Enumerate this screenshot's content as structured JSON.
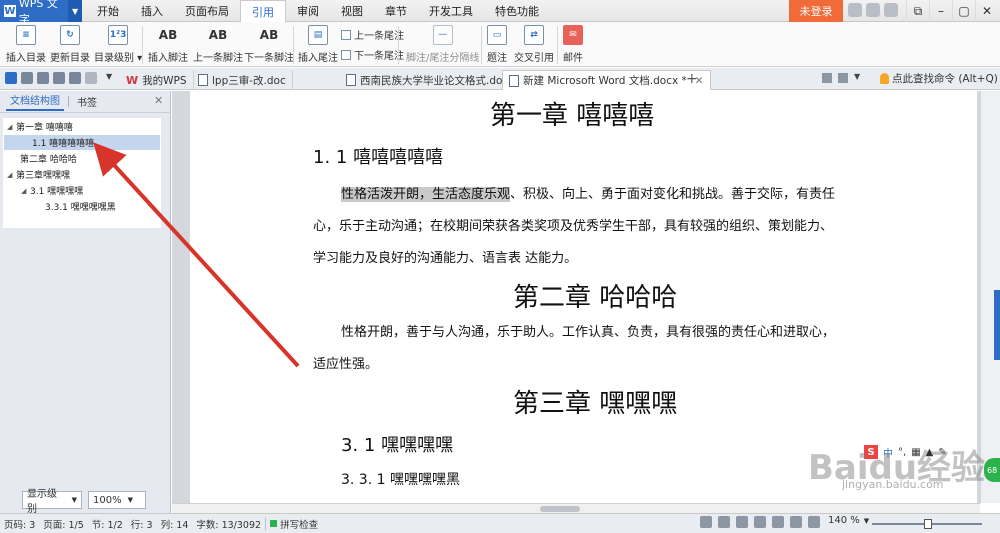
{
  "app": {
    "name": "WPS 文字",
    "login": "未登录"
  },
  "menus": [
    "开始",
    "插入",
    "页面布局",
    "引用",
    "审阅",
    "视图",
    "章节",
    "开发工具",
    "特色功能"
  ],
  "active_menu": "引用",
  "ribbon": {
    "insert_toc": "插入目录",
    "update_toc": "更新目录",
    "toc_level": "目录级别",
    "insert_footnote": "插入脚注",
    "prev_footnote": "上一条脚注",
    "next_footnote": "下一条脚注",
    "insert_endnote": "插入尾注",
    "prev_endnote": "上一条尾注",
    "next_endnote": "下一条尾注",
    "note_separator": "脚注/尾注分隔线",
    "caption": "题注",
    "cross_ref": "交叉引用",
    "mail": "邮件",
    "ab_glyph": "AB"
  },
  "tabs": [
    {
      "label": "我的WPS"
    },
    {
      "label": "lpp三审-改.doc"
    },
    {
      "label": "西南民族大学毕业论文格式.doc"
    },
    {
      "label": "新建 Microsoft Word 文档.docx *"
    }
  ],
  "search_cmd": "点此查找命令 (Alt+Q)",
  "nav": {
    "tab_toc": "文档结构图",
    "tab_bookmark": "书签",
    "tree": [
      {
        "label": "第一章  嘻嘻嘻"
      },
      {
        "label": "1.1  嘻嘻嘻嘻嘻"
      },
      {
        "label": "第二章  哈哈哈"
      },
      {
        "label": "第三章嘿嘿嘿"
      },
      {
        "label": "3.1  嘿嘿嘿嘿"
      },
      {
        "label": "3.3.1  嘿嘿嘿嘿黑"
      }
    ],
    "show_level": "显示级别",
    "zoom": "100%"
  },
  "document": {
    "ch1": "第一章    嘻嘻嘻",
    "s11": "1. 1  嘻嘻嘻嘻嘻",
    "p1_hl": "性格活泼开朗，生活态度乐观",
    "p1_a": "、积极、向上、勇于面对变化和挑战。善于交际，有责任",
    "p1_b": "心，乐于主动沟通；在校期间荣获各类奖项及优秀学生干部，具有较强的组织、策划能力、",
    "p1_c": "学习能力及良好的沟通能力、语言表  达能力。",
    "ch2": "第二章  哈哈哈",
    "p2_a": "性格开朗，善于与人沟通，乐于助人。工作认真、负责，具有很强的责任心和进取心，",
    "p2_b": "适应性强。",
    "ch3": "第三章  嘿嘿嘿",
    "s31": "3. 1  嘿嘿嘿嘿",
    "s331": "3. 3. 1  嘿嘿嘿嘿黑"
  },
  "watermark": {
    "main": "Baidu经验",
    "sub": "jingyan.baidu.com",
    "ime_cn": "中"
  },
  "status": {
    "page_num": "页码: 3",
    "page": "页面: 1/5",
    "section": "节: 1/2",
    "row": "行: 3",
    "col": "列: 14",
    "words": "字数: 13/3092",
    "spell": "拼写检查",
    "zoom": "140 %"
  },
  "colors": {
    "accent": "#2d6dc5",
    "login": "#f06a3a",
    "arrow": "#d8342b"
  }
}
